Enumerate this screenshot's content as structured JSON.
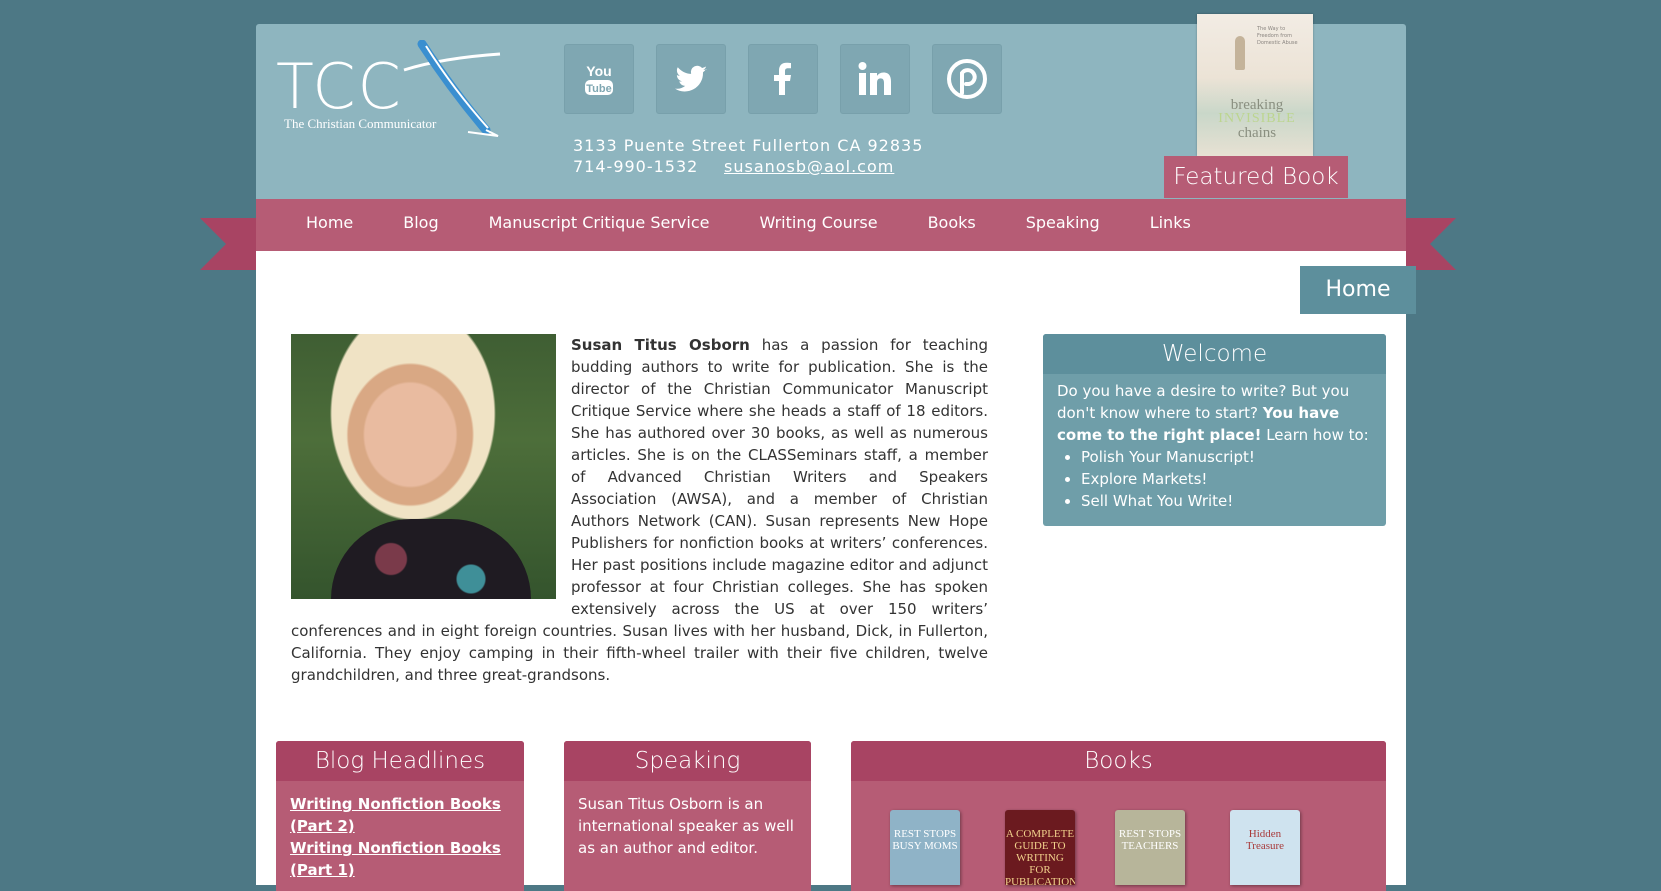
{
  "logo": {
    "letters": "TCC",
    "tagline": "The Christian Communicator"
  },
  "social": [
    {
      "name": "youtube-icon",
      "label": "You Tube"
    },
    {
      "name": "twitter-icon"
    },
    {
      "name": "facebook-icon"
    },
    {
      "name": "linkedin-icon"
    },
    {
      "name": "pinterest-icon"
    }
  ],
  "contact": {
    "address": "3133 Puente Street Fullerton CA 92835",
    "phone": "714-990-1532",
    "email": "susanosb@aol.com"
  },
  "featured": {
    "label": "Featured Book",
    "cover_line1": "breaking",
    "cover_line2": "INVISIBLE",
    "cover_line3": "chains",
    "cover_small": "The Way to Freedom from Domestic Abuse"
  },
  "nav": {
    "items": [
      "Home",
      "Blog",
      "Manuscript Critique Service",
      "Writing Course",
      "Books",
      "Speaking",
      "Links"
    ]
  },
  "page_tab": "Home",
  "bio": {
    "name": "Susan Titus Osborn",
    "text": " has a passion for teaching budding authors to write for publication. She is the director of the Christian Communicator Manuscript Critique Service where she heads a staff of 18 editors. She has authored over 30 books, as well as numerous articles. She is on the CLASSeminars staff, a member of Advanced Christian Writers and Speakers Association (AWSA), and a member of Christian Authors Network (CAN). Susan represents New Hope Publishers for nonfiction books at writers’ conferences. Her past positions include magazine editor and adjunct professor at four Christian colleges. She has spoken extensively across the US at over 150 writers’ conferences and in eight foreign countries. Susan lives with her husband, Dick, in Fullerton, California. They enjoy camping in their fifth-wheel trailer with their five children, twelve grandchildren, and three great-grandsons."
  },
  "welcome": {
    "title": "Welcome",
    "intro": "Do you have a desire to write? But you don't know where to start? ",
    "bold": "You have come to the right place!",
    "after": " Learn how to:",
    "items": [
      "Polish Your Manuscript!",
      "Explore Markets!",
      "Sell What You Write!"
    ]
  },
  "blog": {
    "title": "Blog Headlines",
    "links": [
      "Writing Nonfiction Books (Part 2)",
      "Writing Nonfiction Books (Part 1)"
    ]
  },
  "speaking": {
    "title": "Speaking",
    "text": "Susan Titus Osborn is an international speaker as well as an author and editor."
  },
  "books": {
    "title": "Books",
    "items": [
      {
        "cover": "REST STOPS BUSY MOMS",
        "color": "#8fb3c7"
      },
      {
        "cover": "A COMPLETE GUIDE TO WRITING FOR PUBLICATION",
        "color": "#6b1a1f"
      },
      {
        "cover": "REST STOPS TEACHERS",
        "color": "#b7b59a"
      },
      {
        "cover": "Hidden Treasure",
        "color": "#cfe3ef"
      }
    ]
  },
  "colors": {
    "background": "#4d7885",
    "header": "#8eb5bf",
    "ribbon": "#b65c75",
    "teal_box": "#6f9ea9"
  }
}
